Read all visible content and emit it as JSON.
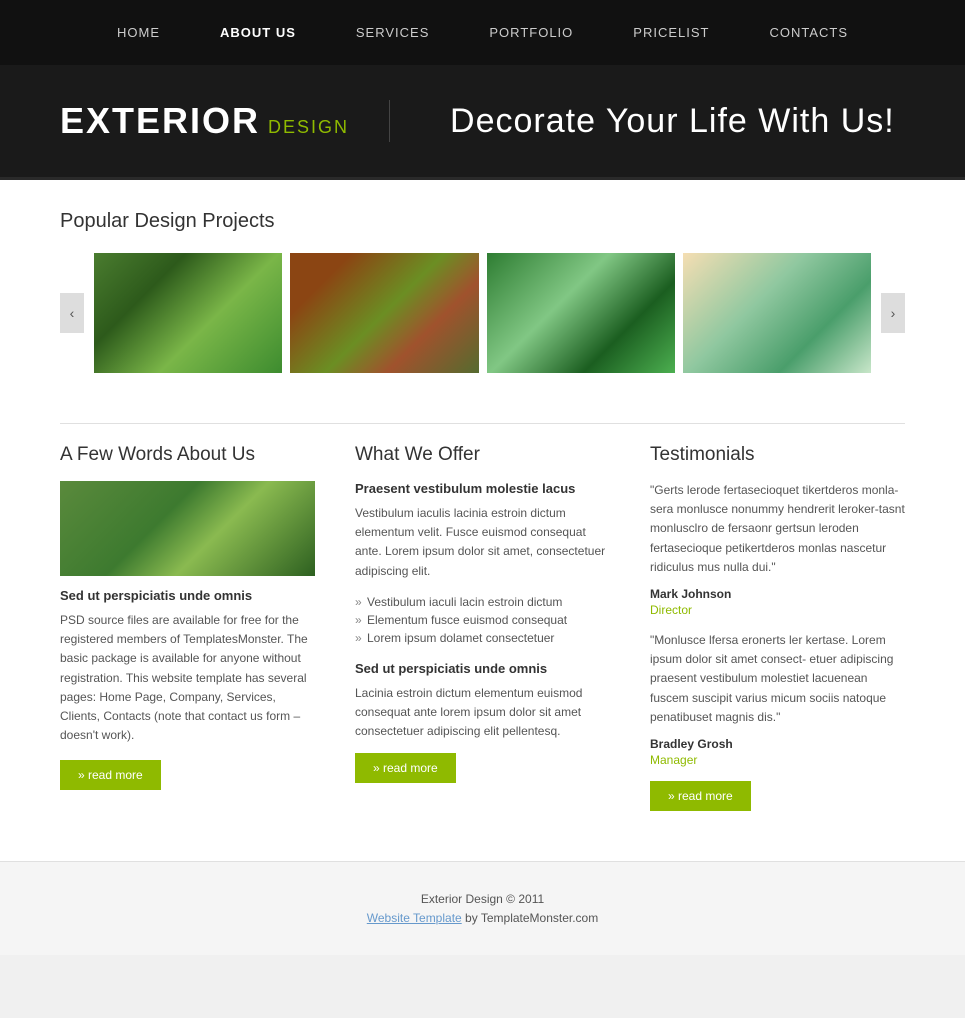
{
  "nav": {
    "items": [
      {
        "label": "HOME",
        "active": false
      },
      {
        "label": "ABOUT US",
        "active": true
      },
      {
        "label": "SERVICES",
        "active": false
      },
      {
        "label": "PORTFOLIO",
        "active": false
      },
      {
        "label": "PRICELIST",
        "active": false
      },
      {
        "label": "CONTACTS",
        "active": false
      }
    ]
  },
  "hero": {
    "brand_main": "EXTERIOR",
    "brand_sub": "DESIGN",
    "tagline": "Decorate Your Life With Us!"
  },
  "projects": {
    "section_title": "Popular Design Projects",
    "prev_label": "‹",
    "next_label": "›"
  },
  "about": {
    "col_title": "A Few Words About Us",
    "subtitle": "Sed ut perspiciatis unde omnis",
    "text": "PSD source files are available for free for the registered members of TemplatesMonster. The basic package is available for anyone without registration. This website template has several pages: Home Page, Company, Services, Clients, Contacts (note that contact us form – doesn't work).",
    "btn_label": "» read more"
  },
  "offer": {
    "col_title": "What We Offer",
    "subtitle1": "Praesent vestibulum molestie lacus",
    "text1": "Vestibulum iaculis lacinia estroin dictum elementum velit. Fusce euismod consequat ante. Lorem ipsum dolor sit amet, consectetuer adipiscing elit.",
    "list_items": [
      "Vestibulum iaculi lacin estroin dictum",
      "Elementum fusce euismod consequat",
      "Lorem ipsum dolamet consectetuer"
    ],
    "subtitle2": "Sed ut perspiciatis unde omnis",
    "text2": "Lacinia estroin dictum elementum euismod consequat ante lorem ipsum dolor sit amet consectetuer adipiscing elit pellentesq.",
    "btn_label": "» read more"
  },
  "testimonials": {
    "col_title": "Testimonials",
    "quote1": "\"Gerts lerode fertasecioquet tikertderos monla-sera monlusce nonummy hendrerit leroker-tasnt monlusclro de fersaonr gertsun leroden fertasecioque petikertderos monlas nascetur ridiculus mus nulla dui.\"",
    "name1": "Mark Johnson",
    "role1": "Director",
    "quote2": "\"Monlusce lfersa eronerts ler kertase. Lorem ipsum dolor sit amet consect- etuer adipiscing praesent vestibulum molestiet lacuenean fuscem suscipit varius micum sociis natoque penatibuset magnis dis.\"",
    "name2": "Bradley Grosh",
    "role2": "Manager",
    "btn_label": "» read more"
  },
  "footer": {
    "copyright": "Exterior Design © 2011",
    "link_text": "Website Template",
    "suffix": " by TemplateMonster.com"
  }
}
